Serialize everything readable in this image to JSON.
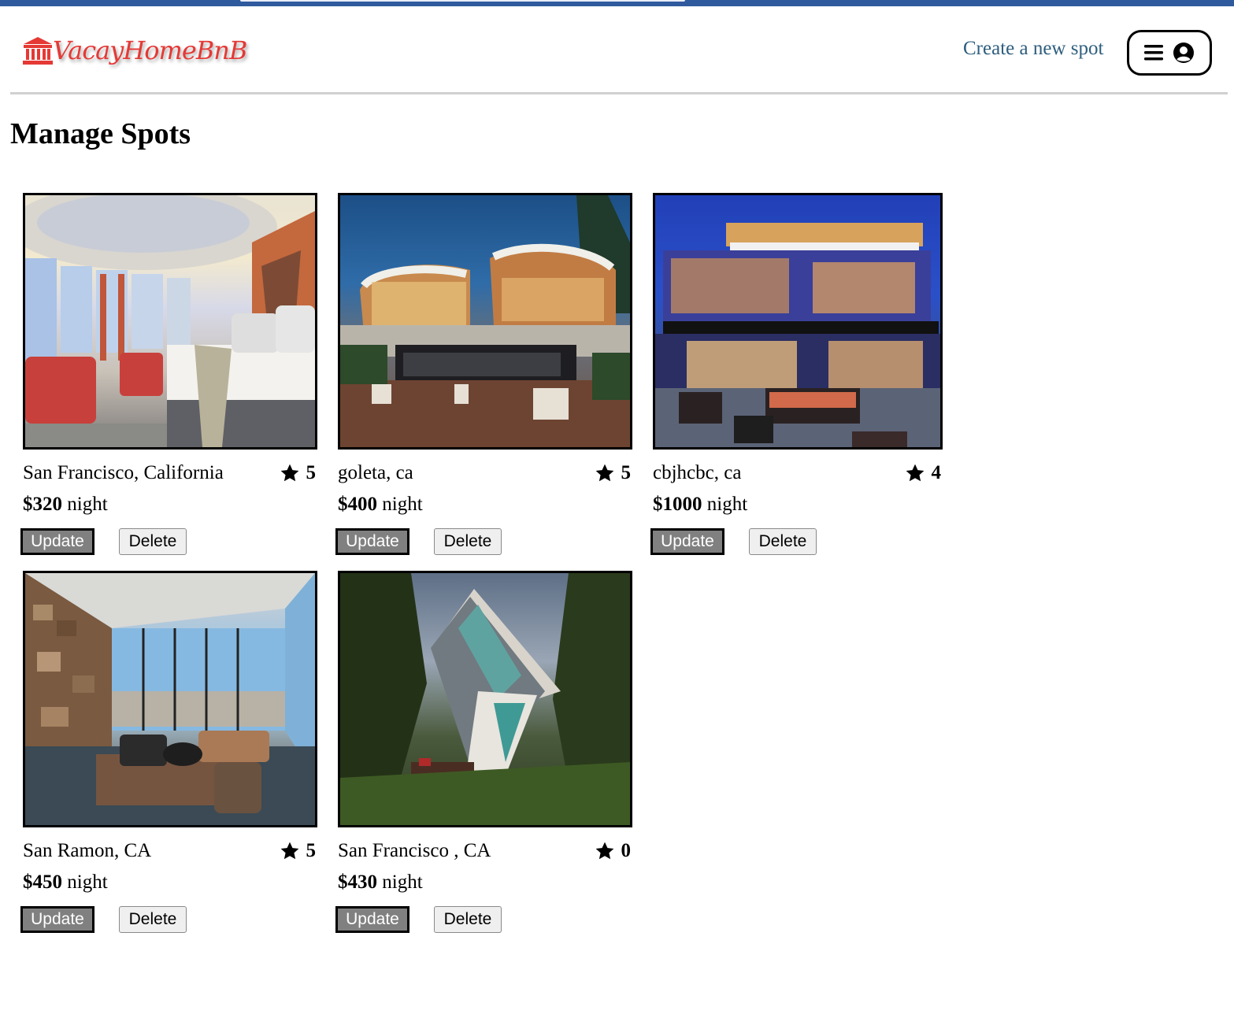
{
  "browser": {
    "top_bar_color": "#2f5a9e"
  },
  "header": {
    "logo_icon": "bank-building-icon",
    "logo_text": "VacayHomeBnB",
    "logo_color": "#e53935",
    "create_link": "Create a new spot",
    "link_color": "#2e5e7e",
    "menu_icon": "hamburger-icon",
    "profile_icon": "user-circle-icon"
  },
  "main": {
    "title": "Manage Spots",
    "spots": [
      {
        "location": "San Francisco, California",
        "rating": "5",
        "price": "$320",
        "unit": "night",
        "update_label": "Update",
        "delete_label": "Delete",
        "image": "hotel-bedroom-golden-gate-photo"
      },
      {
        "location": "goleta, ca",
        "rating": "5",
        "price": "$400",
        "unit": "night",
        "update_label": "Update",
        "delete_label": "Delete",
        "image": "modern-villa-pool-photo"
      },
      {
        "location": "cbjhcbc, ca",
        "rating": "4",
        "price": "$1000",
        "unit": "night",
        "update_label": "Update",
        "delete_label": "Delete",
        "image": "glass-house-night-photo"
      },
      {
        "location": "San Ramon, CA",
        "rating": "5",
        "price": "$450",
        "unit": "night",
        "update_label": "Update",
        "delete_label": "Delete",
        "image": "penthouse-living-room-photo"
      },
      {
        "location": "San Francisco , CA",
        "rating": "0",
        "price": "$430",
        "unit": "night",
        "update_label": "Update",
        "delete_label": "Delete",
        "image": "angular-house-forest-photo"
      }
    ]
  }
}
